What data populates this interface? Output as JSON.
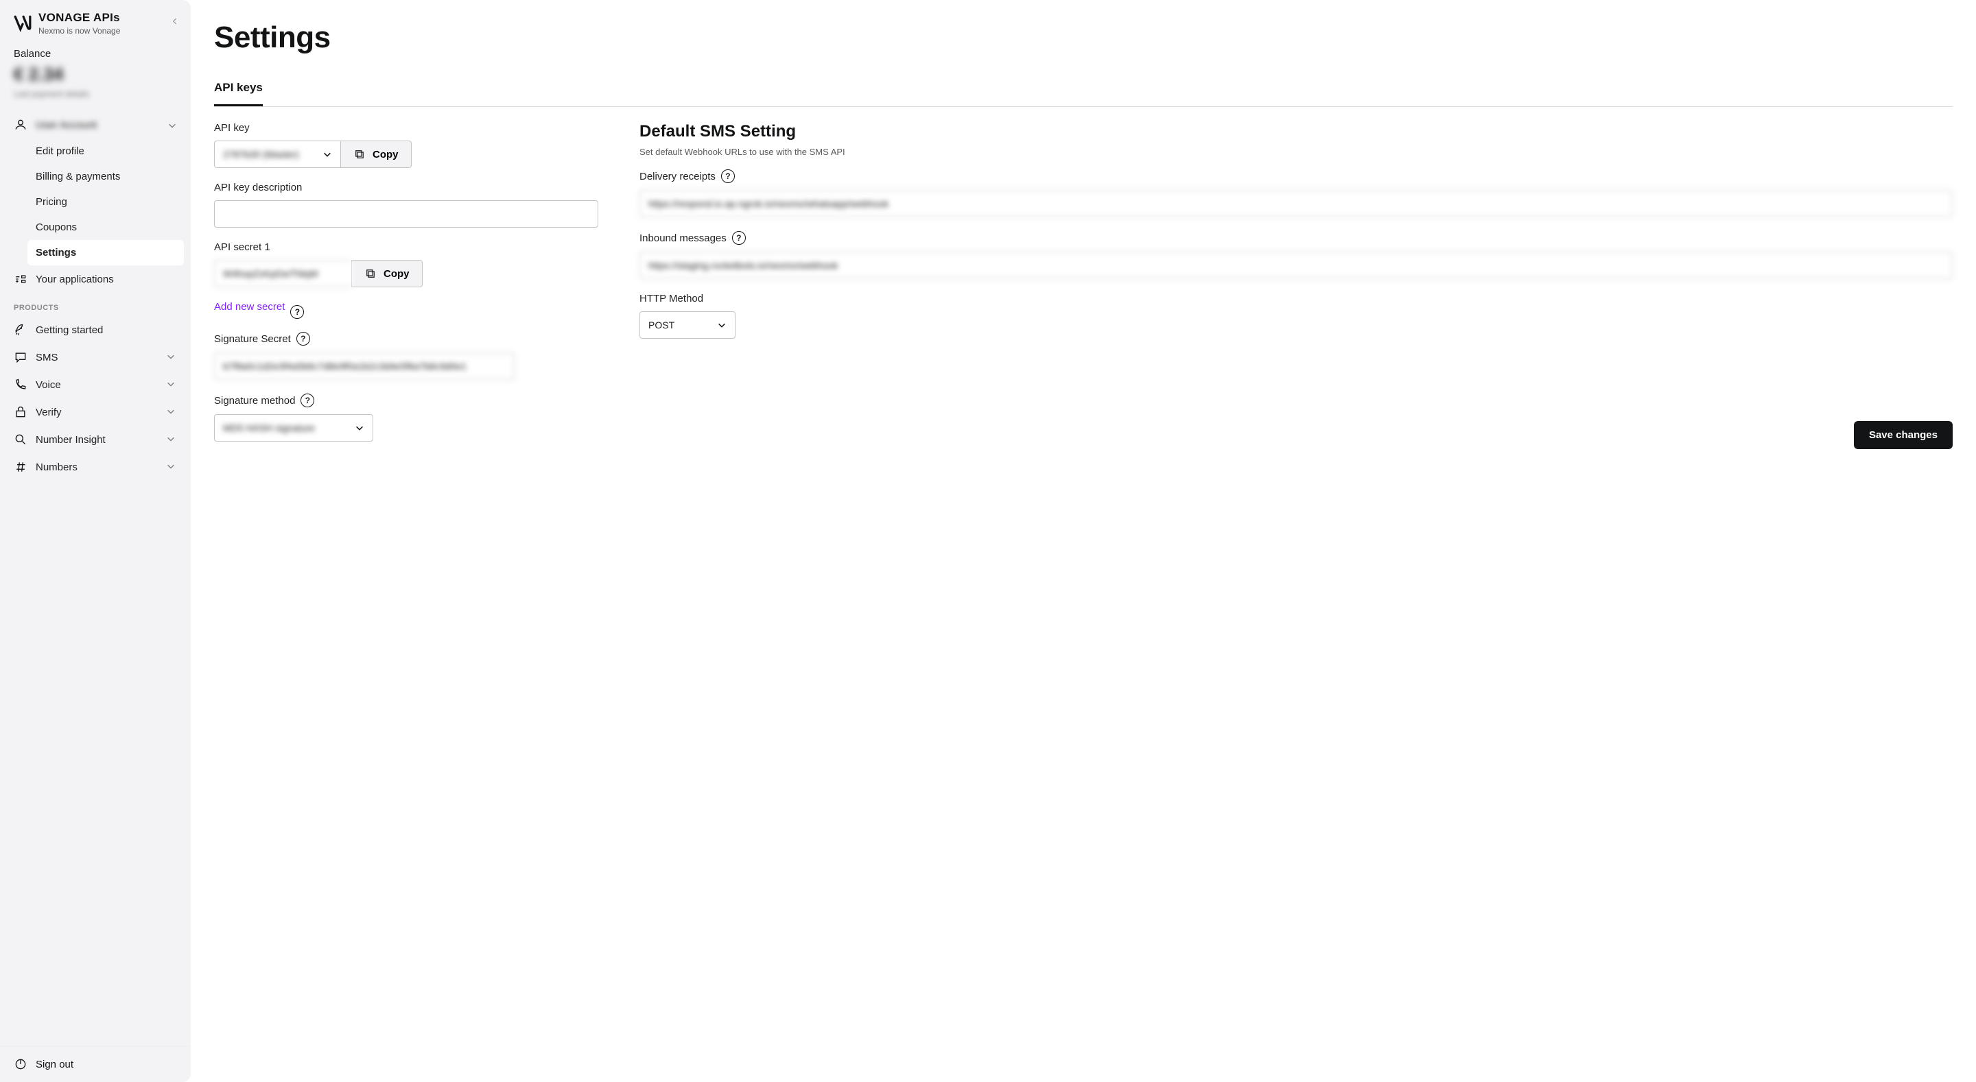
{
  "brand": {
    "title": "VONAGE APIs",
    "subtitle": "Nexmo is now Vonage"
  },
  "balance": {
    "label": "Balance",
    "amount": "€ 2.34",
    "sub": "Last payment details"
  },
  "user": {
    "name": "User Account"
  },
  "user_menu": {
    "edit_profile": "Edit profile",
    "billing": "Billing & payments",
    "pricing": "Pricing",
    "coupons": "Coupons",
    "settings": "Settings"
  },
  "nav": {
    "your_apps": "Your applications",
    "products_label": "PRODUCTS",
    "getting_started": "Getting started",
    "sms": "SMS",
    "voice": "Voice",
    "verify": "Verify",
    "number_insight": "Number Insight",
    "numbers": "Numbers",
    "sign_out": "Sign out"
  },
  "page": {
    "title": "Settings",
    "tab_api_keys": "API keys"
  },
  "api": {
    "key_label": "API key",
    "key_value": "2787b30 (Master)",
    "key_desc_label": "API key description",
    "key_desc_value": "",
    "secret_label": "API secret 1",
    "secret_value": "W4hopZxKpDwTNlqM",
    "add_secret": "Add new secret",
    "sig_secret_label": "Signature Secret",
    "sig_secret_value": "b7f8a0c1d2e3f4a5b6c7d8e9f0a1b2c3d4e5f6a7b8c9d0e1",
    "sig_method_label": "Signature method",
    "sig_method_value": "MD5 HASH signature",
    "copy": "Copy"
  },
  "sms": {
    "title": "Default SMS Setting",
    "desc": "Set default Webhook URLs to use with the SMS API",
    "delivery_label": "Delivery receipts",
    "delivery_value": "https://respond.io.ap.ngrok.io/nexmo/whatsapp/webhook",
    "inbound_label": "Inbound messages",
    "inbound_value": "https://staging.rocketbots.io/nexmo/webhook",
    "http_label": "HTTP Method",
    "http_value": "POST"
  },
  "actions": {
    "save": "Save changes"
  }
}
